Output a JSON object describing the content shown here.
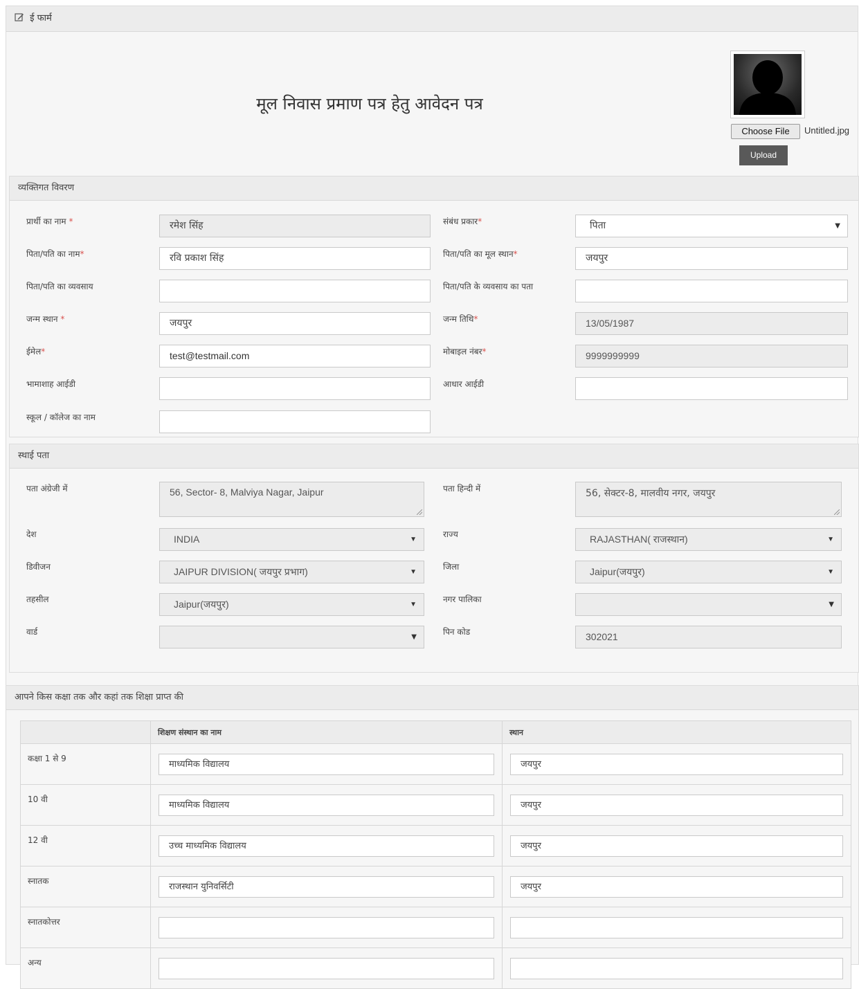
{
  "header": {
    "title": "ई फार्म"
  },
  "form_title": "मूल निवास प्रमाण पत्र हेतु आवेदन पत्र",
  "photo": {
    "choose_label": "Choose File",
    "file_name": "Untitled.jpg",
    "upload_label": "Upload"
  },
  "personal": {
    "heading": "व्यक्तिगत विवरण",
    "fields": {
      "applicant_name": {
        "label": "प्रार्थी का नाम",
        "value": "रमेश  सिंह"
      },
      "relation_type": {
        "label": "संबंध प्रकार",
        "value": "पिता"
      },
      "father_name": {
        "label": "पिता/पति का नाम",
        "value": "रवि प्रकाश सिंह"
      },
      "father_origin": {
        "label": "पिता/पति का मूल स्थान",
        "value": "जयपुर"
      },
      "father_occupation": {
        "label": "पिता/पति का व्यवसाय",
        "value": ""
      },
      "father_occupation_address": {
        "label": "पिता/पति के व्यवसाय का पता",
        "value": ""
      },
      "birth_place": {
        "label": "जन्म स्थान",
        "value": "जयपुर"
      },
      "birth_date": {
        "label": "जन्म तिथि",
        "value": "13/05/1987"
      },
      "email": {
        "label": "ईमेल",
        "value": "test@testmail.com"
      },
      "mobile": {
        "label": "मोबाइल नंबर",
        "value": "9999999999"
      },
      "bhamashah": {
        "label": "भामाशाह आईडी",
        "value": ""
      },
      "aadhar": {
        "label": "आधार आईडी",
        "value": ""
      },
      "school": {
        "label": "स्कूल / कॉलेज का नाम",
        "value": ""
      }
    }
  },
  "address": {
    "heading": "स्थाई पता",
    "fields": {
      "addr_en": {
        "label": "पता अंग्रेजी में",
        "value": "56, Sector- 8, Malviya Nagar, Jaipur"
      },
      "addr_hi": {
        "label": "पता हिन्दी में",
        "value": "56, सेक्टर-8, मालवीय नगर, जयपुर"
      },
      "country": {
        "label": "देश",
        "value": "INDIA"
      },
      "state": {
        "label": "राज्य",
        "value": "RAJASTHAN( राजस्थान)"
      },
      "division": {
        "label": "डिवीजन",
        "value": "JAIPUR DIVISION( जयपुर प्रभाग)"
      },
      "district": {
        "label": "जिला",
        "value": "Jaipur(जयपुर)"
      },
      "tehsil": {
        "label": "तहसील",
        "value": "Jaipur(जयपुर)"
      },
      "municipality": {
        "label": "नगर पालिका",
        "value": ""
      },
      "ward": {
        "label": "वार्ड",
        "value": ""
      },
      "pincode": {
        "label": "पिन कोड",
        "value": "302021"
      }
    }
  },
  "education": {
    "heading": "आपने किस कक्षा तक और कहां तक शिक्षा प्राप्त की",
    "columns": [
      "",
      "शिक्षण संस्थान का नाम",
      "स्थान"
    ],
    "rows": [
      {
        "level": "कक्षा 1 से 9",
        "institute": "माध्यमिक विद्यालय",
        "place": "जयपुर"
      },
      {
        "level": "10 वी",
        "institute": "माध्यमिक विद्यालय",
        "place": "जयपुर"
      },
      {
        "level": "12 वी",
        "institute": "उच्च माध्यमिक विद्यालय",
        "place": "जयपुर"
      },
      {
        "level": "स्नातक",
        "institute": "राजस्थान युनिवर्सिटी",
        "place": "जयपुर"
      },
      {
        "level": "स्नातकोत्तर",
        "institute": "",
        "place": ""
      },
      {
        "level": "अन्य",
        "institute": "",
        "place": ""
      }
    ]
  },
  "colors": {
    "required": "#d9534f",
    "upload_button": "#595959",
    "readonly_bg": "#ececec"
  }
}
